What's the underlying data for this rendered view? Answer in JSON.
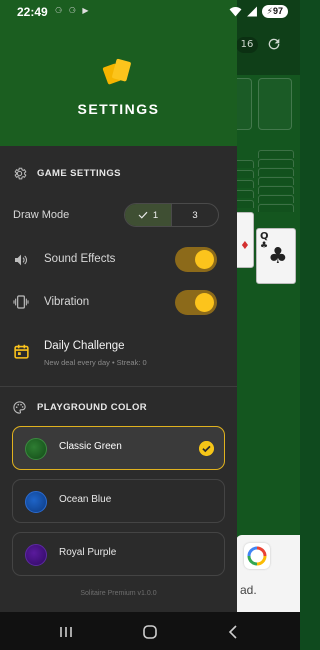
{
  "status_bar": {
    "time": "22:49",
    "left_icons": "⚆ ⚆ ▶",
    "battery": "97"
  },
  "background_game": {
    "counter": "16",
    "cards": [
      {
        "rank": "",
        "suit": "♦",
        "color": "#d32f2f"
      },
      {
        "rank": "Q",
        "suit": "♣",
        "color": "#222222"
      }
    ],
    "ad_text": "ad."
  },
  "drawer": {
    "title": "SETTINGS",
    "game_settings": {
      "heading": "GAME SETTINGS",
      "draw_mode": {
        "label": "Draw Mode",
        "options": [
          "1",
          "3"
        ],
        "selected": "1"
      },
      "sound_effects": {
        "label": "Sound Effects",
        "on": true
      },
      "vibration": {
        "label": "Vibration",
        "on": true
      },
      "daily_challenge": {
        "title": "Daily Challenge",
        "subtitle": "New deal every day • Streak: 0"
      }
    },
    "playground_color": {
      "heading": "PLAYGROUND COLOR",
      "options": [
        {
          "name": "Classic Green",
          "color": "#1b5e20",
          "selected": true
        },
        {
          "name": "Ocean Blue",
          "color": "#1565c0",
          "selected": false
        },
        {
          "name": "Royal Purple",
          "color": "#4a148c",
          "selected": false
        }
      ]
    },
    "version": "Solitaire Premium v1.0.0"
  },
  "colors": {
    "header_green": "#1b5e20",
    "accent_yellow": "#fcc41c",
    "drawer_bg": "#2b2b2b"
  },
  "nav_bar": {
    "icons": [
      "recents-icon",
      "home-icon",
      "back-icon"
    ]
  }
}
